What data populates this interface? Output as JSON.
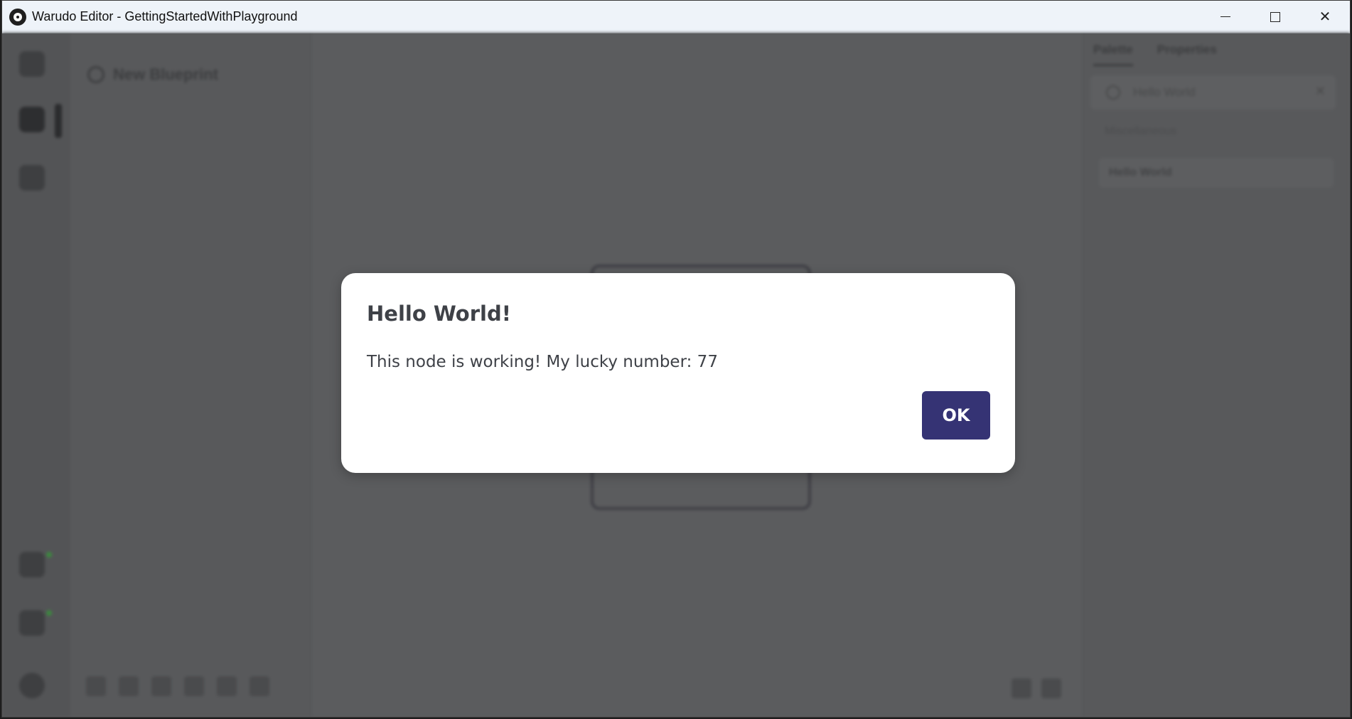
{
  "window": {
    "title": "Warudo Editor - GettingStartedWithPlayground",
    "controls": {
      "minimize": "minimize-icon",
      "maximize": "maximize-icon",
      "close": "close-icon"
    }
  },
  "background": {
    "outline_title": "New Blueprint",
    "right_panel": {
      "tabs": [
        "Palette",
        "Properties"
      ],
      "search_placeholder": "Hello World",
      "section": "Miscellaneous",
      "item": "Hello World"
    }
  },
  "dialog": {
    "title": "Hello World!",
    "message": "This node is working! My lucky number: 77",
    "ok_label": "OK"
  },
  "colors": {
    "accent": "#353374",
    "overlay": "#5a5b5d",
    "dialog_bg": "#ffffff",
    "text": "#3e4147"
  }
}
